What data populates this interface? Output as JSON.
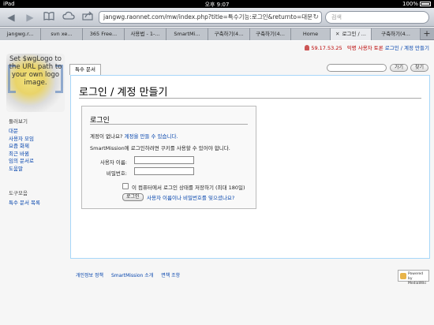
{
  "statusbar": {
    "device": "iPad",
    "time": "오후 9:07",
    "battery": "100%"
  },
  "toolbar": {
    "url": "jangwg.raonnet.com/mw/index.php?title=특수기능:로그인&returnto=대문",
    "search_placeholder": "검색",
    "icons": [
      "back-icon",
      "forward-icon",
      "bookmarks-icon",
      "cloud-icon",
      "share-icon",
      "reload-icon"
    ]
  },
  "tabs": [
    {
      "label": "jangwg.r..."
    },
    {
      "label": "svn xe..."
    },
    {
      "label": "365 Free..."
    },
    {
      "label": "사용법 - 1-..."
    },
    {
      "label": "SmartMi..."
    },
    {
      "label": "구축하기(4..."
    },
    {
      "label": "구축하기(4..."
    },
    {
      "label": "Home"
    },
    {
      "label": "로그인 / ..."
    },
    {
      "label": "구축하기(4..."
    }
  ],
  "personal": {
    "ip": "59.17.53.25",
    "anon_talk": "익명 사용자 토론",
    "login_link": "로그인 / 계정 만들기"
  },
  "logo": {
    "text": "Set $wgLogo to the URL path to your own logo image."
  },
  "page_tab": {
    "label": "특수 문서"
  },
  "search": {
    "go": "가기",
    "find": "찾기"
  },
  "page_title": "로그인 / 계정 만들기",
  "login": {
    "legend": "로그인",
    "no_account_prefix": "계정이 없나요?",
    "create_account_link": "계정을 만들 수 있습니다.",
    "cookie_note": "SmartMission에 로그인하려면 쿠키를 사용할 수 있어야 합니다.",
    "username_label": "사용자 이름:",
    "password_label": "비밀번호:",
    "remember_label": "이 컴퓨터에서 로그인 상태를 저장하기 (최대 180일)",
    "login_button": "로그인",
    "forgot_link": "사용자 이름이나 비밀번호를 잊으셨나요?"
  },
  "sidebar": {
    "nav_header": "둘러보기",
    "nav_items": [
      "대문",
      "사용자 모임",
      "요즘 화제",
      "최근 바뀜",
      "임의 문서로",
      "도움말"
    ],
    "tools_header": "도구모음",
    "tools_items": [
      "특수 문서 목록"
    ]
  },
  "footer": {
    "links": [
      "개인정보 정책",
      "SmartMission 소개",
      "면책 조항"
    ],
    "badge": "Powered by MediaWiki"
  }
}
